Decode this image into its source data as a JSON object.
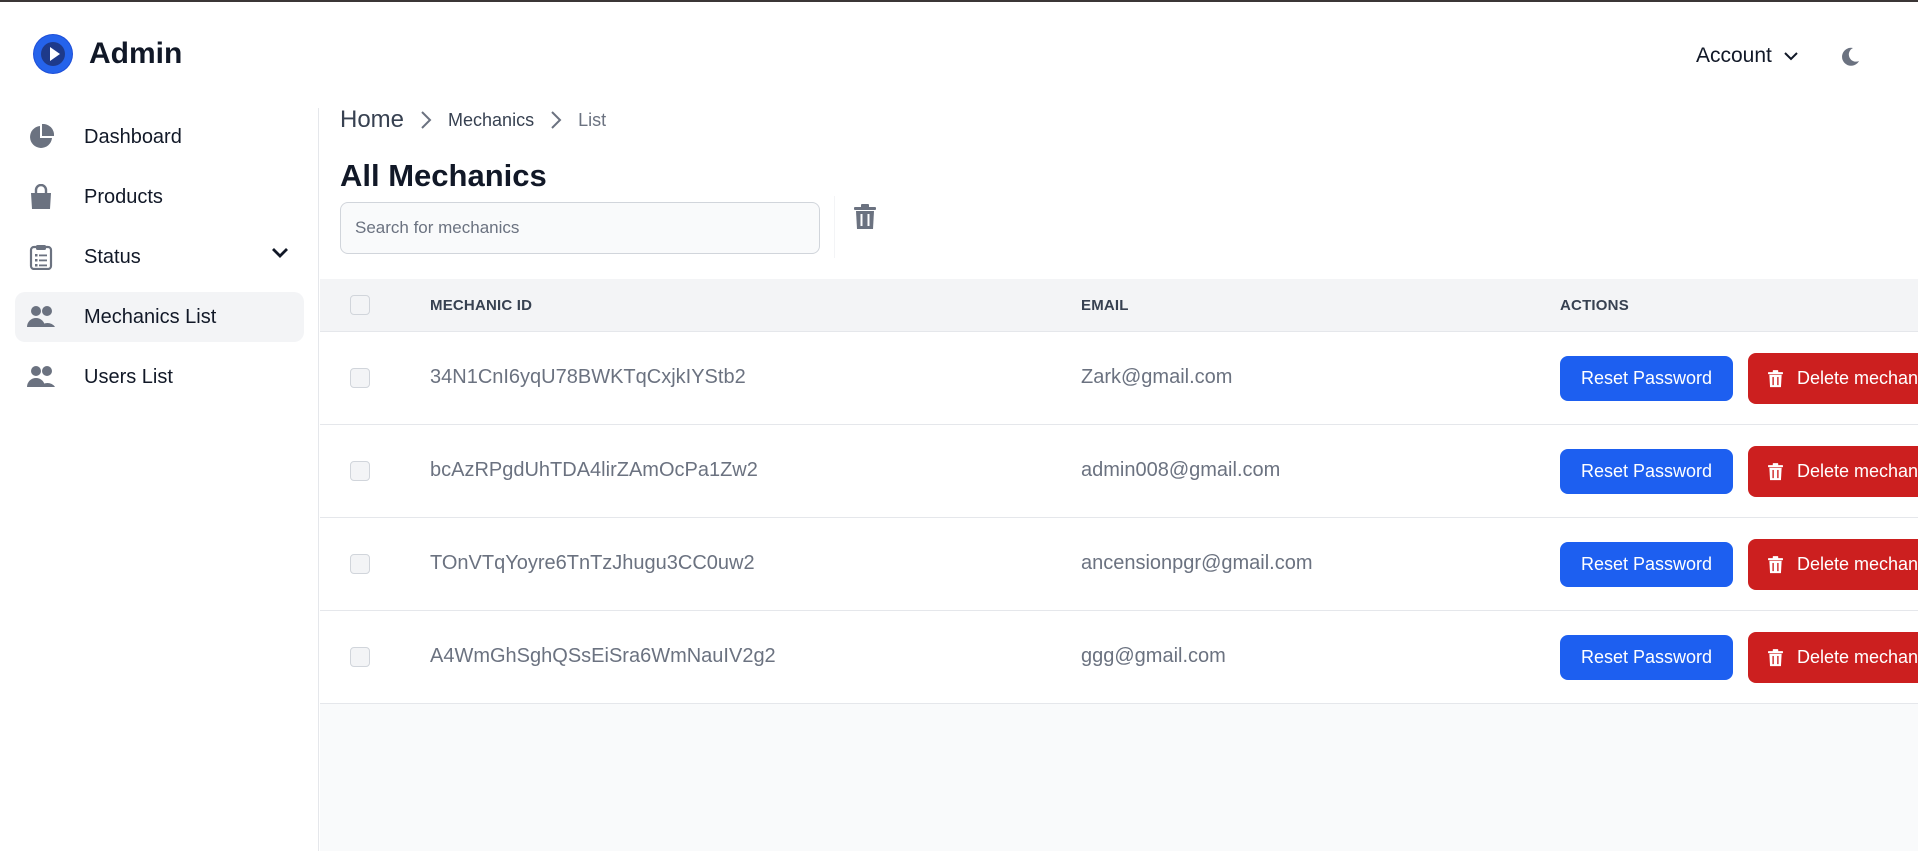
{
  "app": {
    "title": "Admin",
    "logo_icon": "play-logo-icon",
    "accent_color": "#1d5ff0",
    "danger_color": "#cc1f1f"
  },
  "header": {
    "account_label": "Account",
    "theme_icon": "moon-icon"
  },
  "sidebar": {
    "items": [
      {
        "label": "Dashboard",
        "icon": "pie-chart-icon"
      },
      {
        "label": "Products",
        "icon": "shopping-bag-icon"
      },
      {
        "label": "Status",
        "icon": "clipboard-icon",
        "has_submenu": true
      },
      {
        "label": "Mechanics List",
        "icon": "users-icon",
        "active": true
      },
      {
        "label": "Users List",
        "icon": "users-icon"
      }
    ]
  },
  "breadcrumb": {
    "home": "Home",
    "items": [
      "Mechanics",
      "List"
    ]
  },
  "page": {
    "title": "All Mechanics",
    "search_placeholder": "Search for mechanics"
  },
  "table": {
    "columns": [
      "MECHANIC ID",
      "EMAIL",
      "ACTIONS"
    ],
    "reset_label": "Reset Password",
    "delete_label": "Delete mechanic",
    "rows": [
      {
        "id": "34N1CnI6yqU78BWKTqCxjkIYStb2",
        "email": "Zark@gmail.com"
      },
      {
        "id": "bcAzRPgdUhTDA4lirZAmOcPa1Zw2",
        "email": "admin008@gmail.com"
      },
      {
        "id": "TOnVTqYoyre6TnTzJhugu3CC0uw2",
        "email": "ancensionpgr@gmail.com"
      },
      {
        "id": "A4WmGhSghQSsEiSra6WmNauIV2g2",
        "email": "ggg@gmail.com"
      }
    ]
  }
}
